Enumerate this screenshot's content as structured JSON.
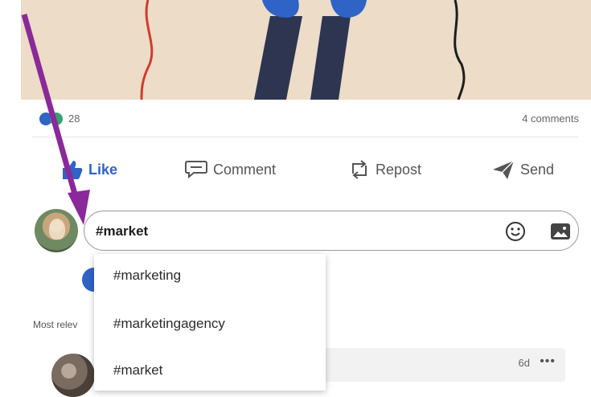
{
  "post": {
    "reaction_count": "28",
    "comments_count": "4 comments"
  },
  "actions": {
    "like": "Like",
    "comment": "Comment",
    "repost": "Repost",
    "send": "Send"
  },
  "comment_input": {
    "value": "#market"
  },
  "hashtag_suggestions": [
    "#marketing",
    "#marketingagency",
    "#market"
  ],
  "comments_section": {
    "sort_label": "Most relev",
    "first_comment_time": "6d"
  },
  "colors": {
    "accent": "#2f63c5",
    "annotation_arrow": "#8a2a9a"
  },
  "icons": {
    "like": "thumbs-up-icon",
    "comment": "speech-bubble-icon",
    "repost": "repost-arrows-icon",
    "send": "paper-plane-icon",
    "emoji": "smiley-icon",
    "image": "photo-icon",
    "more": "more-dots-icon"
  }
}
